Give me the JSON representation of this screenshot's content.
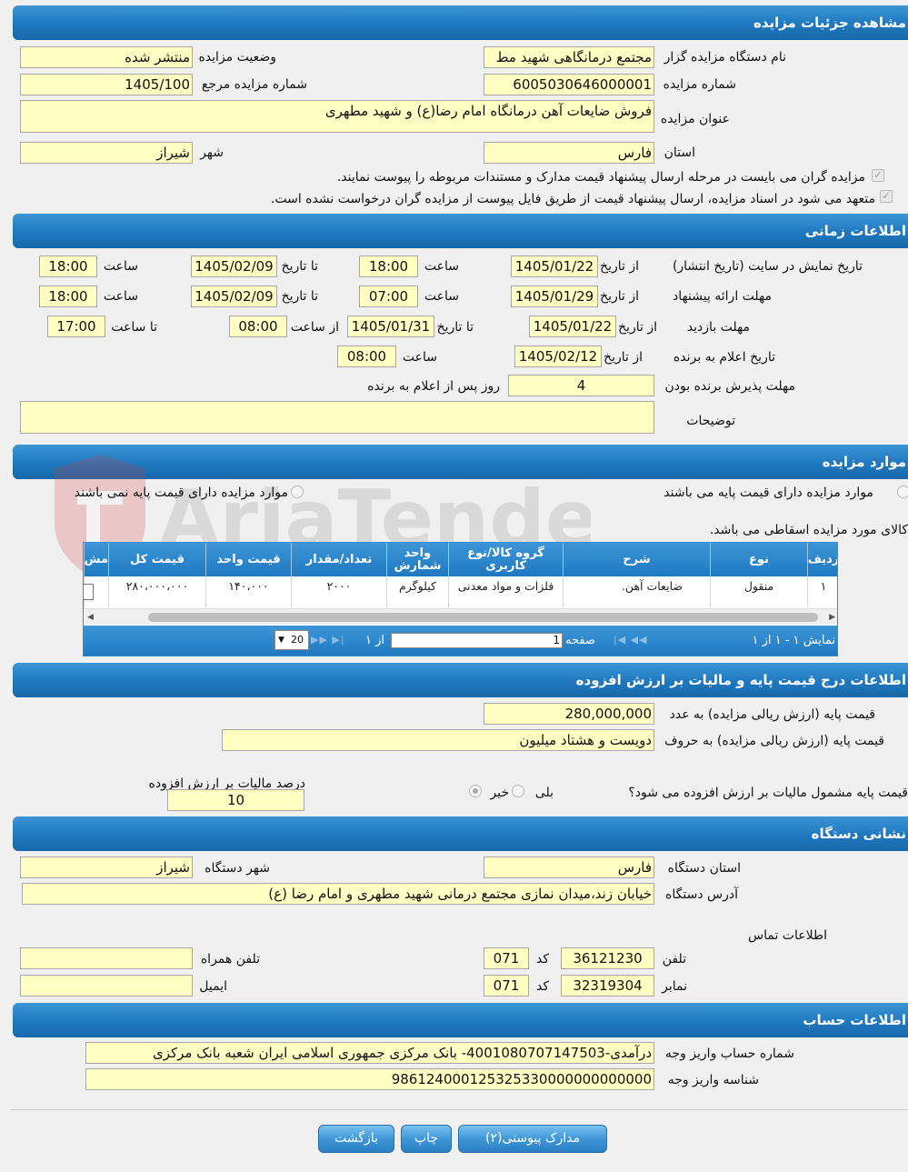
{
  "sections": {
    "details": "مشاهده جزئیات مزایده",
    "timing": "اطلاعات زمانی",
    "items": "موارد مزایده",
    "base_price": "اطلاعات درج قیمت پایه و مالیات بر ارزش افزوده",
    "address": "نشانی دستگاه",
    "account": "اطلاعات حساب"
  },
  "details": {
    "org_label": "نام دستگاه مزایده گزار",
    "org_value": "مجتمع درمانگاهی شهید مط",
    "status_label": "وضعیت مزایده",
    "status_value": "منتشر شده",
    "number_label": "شماره مزایده",
    "number_value": "6005030646000001",
    "ref_label": "شماره مزایده مرجع",
    "ref_value": "1405/100",
    "title_label": "عنوان مزایده",
    "title_value": "فروش ضایعات آهن درمانگاه امام رضا(ع) و شهید مطهری",
    "province_label": "استان",
    "province_value": "فارس",
    "city_label": "شهر",
    "city_value": "شیراز",
    "check1": "مزایده گران می بایست در مرحله ارسال پیشنهاد قیمت مدارک و مستندات مربوطه را پیوست نمایند.",
    "check2": "متعهد می شود در اسناد مزایده، ارسال پیشنهاد قیمت از طریق فایل پیوست از مزایده گران درخواست نشده است."
  },
  "timing": {
    "r1_label": "تاریخ نمایش در سایت (تاریخ انتشار)",
    "r2_label": "مهلت ارائه پیشنهاد",
    "r3_label": "مهلت بازدید",
    "r4_label": "تاریخ اعلام به برنده",
    "r5_label": "مهلت پذیرش برنده بودن",
    "from_date": "از تاریخ",
    "to_date": "تا تاریخ",
    "hour": "ساعت",
    "from_hour": "از ساعت",
    "to_hour": "تا ساعت",
    "r1_from": "1405/01/22",
    "r1_from_time": "18:00",
    "r1_to": "1405/02/09",
    "r1_to_time": "18:00",
    "r2_from": "1405/01/29",
    "r2_from_time": "07:00",
    "r2_to": "1405/02/09",
    "r2_to_time": "18:00",
    "r3_from": "1405/01/22",
    "r3_to": "1405/01/31",
    "r3_from_time": "08:00",
    "r3_to_time": "17:00",
    "r4_from": "1405/02/12",
    "r4_time": "08:00",
    "r5_value": "4",
    "r5_suffix": "روز پس از اعلام به برنده",
    "notes_label": "توضیحات",
    "notes_value": ""
  },
  "items": {
    "radio_with": "موارد مزایده دارای قیمت پایه می باشند",
    "radio_without": "موارد مزایده دارای قیمت پایه نمی باشند",
    "note": "کالای مورد مزایده اسقاطی می باشد.",
    "columns": [
      "ردیف",
      "نوع",
      "شرح",
      "گروه کالا/نوع کاربری",
      "واحد شمارش",
      "تعداد/مقدار",
      "قیمت واحد",
      "قیمت کل",
      "مش"
    ],
    "rows": [
      [
        "۱",
        "منقول",
        "ضایعات آهن.",
        "فلزات و مواد معدنی",
        "کیلوگرم",
        "۲۰۰۰",
        "۱۴۰،۰۰۰",
        "۲۸۰،۰۰۰،۰۰۰",
        ""
      ]
    ],
    "pager": {
      "showing": "نمایش ۱ - ۱ از ۱",
      "page_label": "صفحه",
      "page_value": "1",
      "of": "از ۱",
      "page_size": "20"
    }
  },
  "base_price": {
    "num_label": "قیمت پایه (ارزش ریالی مزایده) به عدد",
    "num_value": "280,000,000",
    "words_label": "قیمت پایه (ارزش ریالی مزایده) به حروف",
    "words_value": "دویست و هشتاد میلیون",
    "vat_question": "قیمت پایه مشمول مالیات بر ارزش افزوده می شود؟",
    "yes": "بلی",
    "no": "خیر",
    "vat_pct_label": "درصد مالیات بر ارزش افزوده",
    "vat_pct_value": "10"
  },
  "address": {
    "province_label": "استان دستگاه",
    "province_value": "فارس",
    "city_label": "شهر دستگاه",
    "city_value": "شیراز",
    "addr_label": "آدرس دستگاه",
    "addr_value": "خیابان زند،میدان نمازی مجتمع درمانی شهید مطهری و امام رضا (ع)",
    "contact_label": "اطلاعات تماس",
    "phone_label": "تلفن",
    "phone_value": "36121230",
    "code_label": "کد",
    "phone_code": "071",
    "fax_label": "نمابر",
    "fax_value": "32319304",
    "fax_code": "071",
    "mobile_label": "تلفن همراه",
    "mobile_value": "",
    "email_label": "ایمیل",
    "email_value": ""
  },
  "account": {
    "acc_label": "شماره حساب واریز وجه",
    "acc_value": "درآمدی-4001080707147503- بانک مرکزی جمهوری اسلامی ایران شعبه بانک مرکزی",
    "id_label": "شناسه واریز وجه",
    "id_value": "986124000125325330000000000000"
  },
  "buttons": {
    "attachments": "مدارک پیوستی(۲)",
    "print": "چاپ",
    "back": "بازگشت"
  },
  "watermark": "AriaTender.neT"
}
